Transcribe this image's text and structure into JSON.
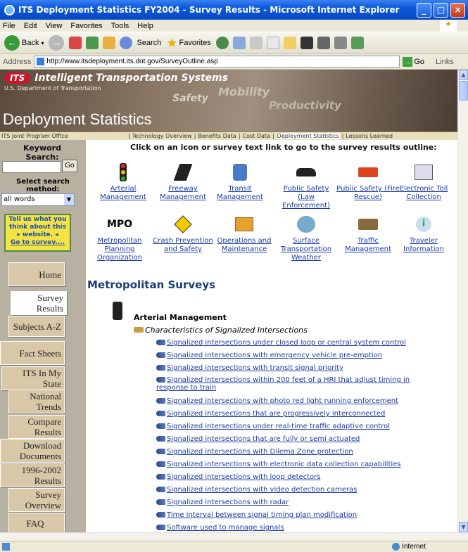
{
  "window": {
    "title": "ITS Deployment Statistics FY2004 - Survey Results - Microsoft Internet Explorer"
  },
  "menu": [
    "File",
    "Edit",
    "View",
    "Favorites",
    "Tools",
    "Help"
  ],
  "toolbar": {
    "back": "Back",
    "search": "Search",
    "favorites": "Favorites"
  },
  "address": {
    "label": "Address",
    "url": "http://www.itsdeployment.its.dot.gov/SurveyOutline.asp",
    "go": "Go",
    "links": "Links"
  },
  "status": {
    "zone": "Internet"
  },
  "banner": {
    "logo": "ITS",
    "title": "Intelligent Transportation Systems",
    "dot": "U.S. Department of Transportation",
    "word_safety": "Safety",
    "word_mobility": "Mobility",
    "word_productivity": "Productivity",
    "heading": "Deployment Statistics"
  },
  "nav": {
    "jpo": "ITS Joint Program Office",
    "items": [
      "Technology Overview",
      "Benefits Data",
      "Cost Data",
      "Deployment Statistics",
      "Lessons Learned"
    ]
  },
  "left": {
    "keyword": "Keyword Search:",
    "go": "Go",
    "select_label": "Select search method:",
    "select_value": "all words",
    "tellus": "Tell us what you think about this",
    "tellus2": "website.",
    "tellus_link": "Go to survey....",
    "nav": [
      "Home",
      "Survey Results",
      "Subjects A-Z",
      "Fact Sheets",
      "ITS In My State",
      "National Trends",
      "Compare Results",
      "Download Documents",
      "1996-2002 Results",
      "Survey Overview",
      "FAQ"
    ]
  },
  "instruction": "Click on an icon or survey text link to go to the survey results outline:",
  "icons": [
    "Arterial Management",
    "Freeway Management",
    "Transit Management",
    "Public Safety (Law Enforcement)",
    "Public Safety (Fire Rescue)",
    "Electronic Toll Collection",
    "Metropolitan Planning Organization",
    "Crash Prevention and Safety",
    "Operations and Maintenance",
    "Surface Transportation Weather",
    "Traffic Management",
    "Traveler Information"
  ],
  "mpo_icon_text": "MPO",
  "main": {
    "heading": "Metropolitan Surveys",
    "section": "Arterial Management",
    "subsection": "Characteristics of Signalized Intersections",
    "links": [
      "Signalized intersections under closed loop or central system control",
      "Signalized intersections with emergency vehicle pre-emption",
      "Signalized intersections with transit signal priority",
      "Signalized intersections within 200 feet of a HRI that adjust timing in response to train",
      "Signalized intersections with photo red light running enforcement",
      "Signalized intersections that are progressively interconnected",
      "Signalized intersections under real-time traffic adaptive control",
      "Signalized intersections that are fully or semi actuated",
      "Signalized intersections with Dilema Zone protection",
      "Signalized intersections with electronic data collection capabilities",
      "Signalized intersections with loop detectors",
      "Signalized intersections with video detection cameras",
      "Signalized intersections with radar",
      "Time interval between signal timing plan modification",
      "Software used to manage signals"
    ]
  }
}
